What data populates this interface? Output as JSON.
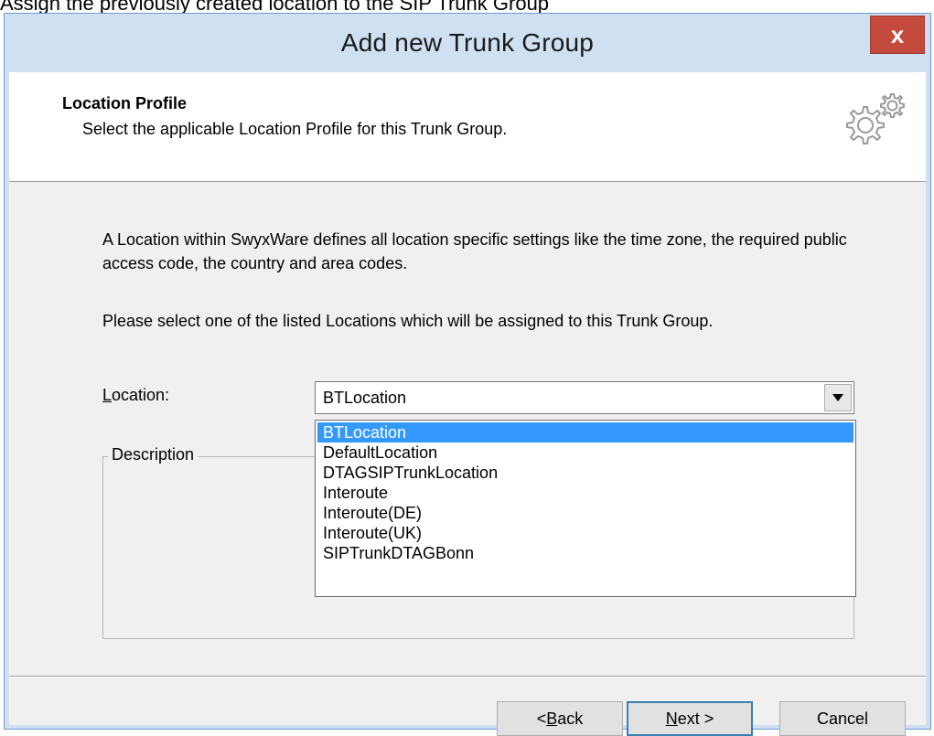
{
  "top_caption": "Assign the previously created location to the SIP Trunk Group",
  "window": {
    "title": "Add new Trunk Group",
    "close_label": "x"
  },
  "header": {
    "title": "Location Profile",
    "subtitle": "Select the applicable Location Profile for this Trunk Group.",
    "icon": "gears-icon"
  },
  "body": {
    "intro": "A Location within SwyxWare defines all location specific settings like the time zone, the required public access code, the country and area codes.",
    "instruction": "Please select one of the listed Locations which will be assigned to this Trunk Group."
  },
  "location": {
    "label_accel": "L",
    "label_rest": "ocation:",
    "selected": "BTLocation",
    "options": [
      "BTLocation",
      "DefaultLocation",
      "DTAGSIPTrunkLocation",
      "Interoute",
      "Interoute(DE)",
      "Interoute(UK)",
      "SIPTrunkDTAGBonn"
    ]
  },
  "description": {
    "label": "Description"
  },
  "buttons": {
    "back_prefix": "< ",
    "back_accel": "B",
    "back_rest": "ack",
    "next_accel": "N",
    "next_rest": "ext >",
    "cancel": "Cancel"
  },
  "colors": {
    "selection": "#3399ff",
    "close_button": "#c44a3e",
    "window_border": "#cfe0f3"
  }
}
